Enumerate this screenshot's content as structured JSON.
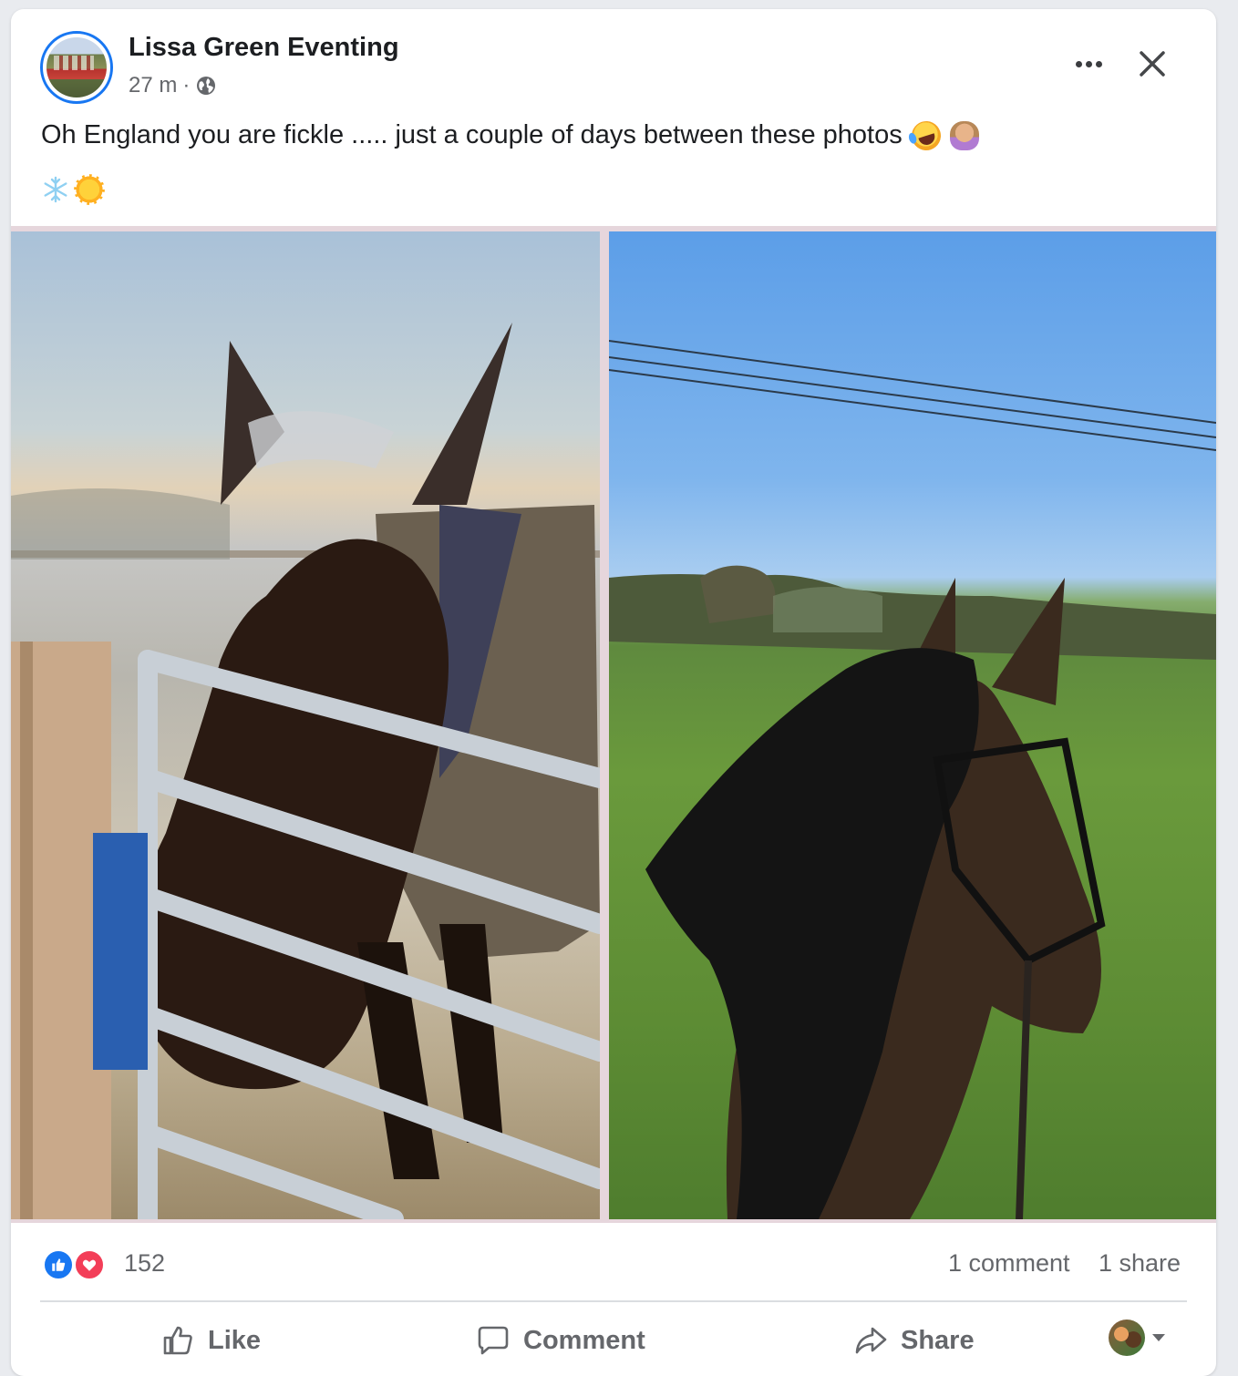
{
  "post": {
    "author": "Lissa Green Eventing",
    "time": "27 m",
    "separator": "·",
    "audience_icon": "globe-icon",
    "text": "Oh England you are fickle ..... just a couple of days between these photos",
    "text_emojis": [
      "rolling-on-floor-laughing-emoji",
      "facepalm-emoji"
    ],
    "second_line_emojis": [
      "snowflake-emoji",
      "sun-emoji"
    ]
  },
  "photos": [
    {
      "name": "frosty-horse-photo",
      "description_icon": "image"
    },
    {
      "name": "sunny-horse-photo",
      "description_icon": "image"
    }
  ],
  "stats": {
    "reactions": [
      "like",
      "love"
    ],
    "reaction_count": "152",
    "comments": "1 comment",
    "shares": "1 share"
  },
  "actions": {
    "like": "Like",
    "comment": "Comment",
    "share": "Share"
  },
  "colors": {
    "brand_blue": "#1877f2",
    "love_red": "#f33e58",
    "secondary_text": "#65676b"
  }
}
